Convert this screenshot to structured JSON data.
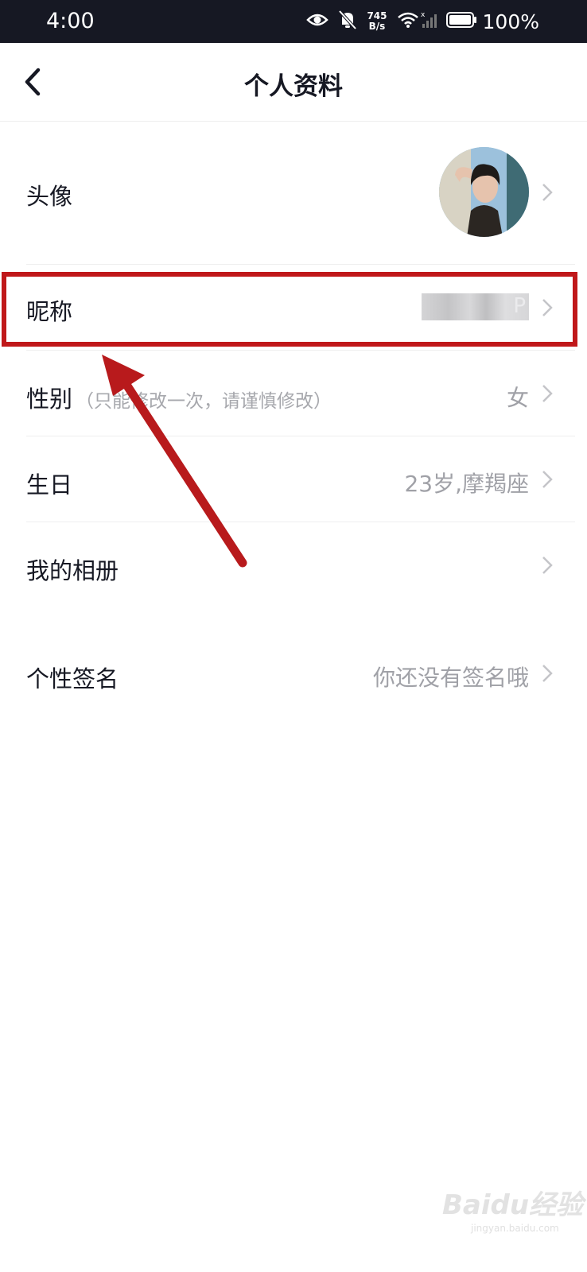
{
  "status_bar": {
    "time": "4:00",
    "net_speed_value": "745",
    "net_speed_unit": "B/s",
    "battery": "100%",
    "icons": [
      "eye-icon",
      "bell-off-icon",
      "wifi-icon",
      "signal-icon",
      "battery-icon"
    ]
  },
  "nav": {
    "back_icon": "chevron-left-icon",
    "title": "个人资料"
  },
  "rows": {
    "avatar": {
      "label": "头像"
    },
    "nickname": {
      "label": "昵称",
      "value_char": "P"
    },
    "gender": {
      "label": "性别",
      "hint": "（只能修改一次，请谨慎修改）",
      "value": "女"
    },
    "birthday": {
      "label": "生日",
      "value": "23岁,摩羯座"
    },
    "album": {
      "label": "我的相册"
    },
    "signature": {
      "label": "个性签名",
      "value": "你还没有签名哦"
    }
  },
  "watermark": {
    "text": "Baidu经验",
    "sub": "jingyan.baidu.com"
  },
  "colors": {
    "status_bar_bg": "#161823",
    "highlight": "#c0181a",
    "secondary_text": "#a0a1a7"
  }
}
